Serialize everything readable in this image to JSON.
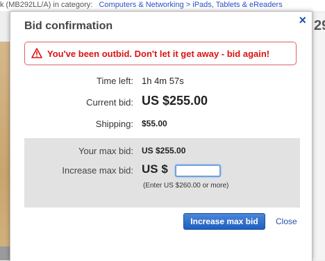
{
  "background": {
    "breadcrumb_prefix": "k (MB292LL/A) in category:",
    "breadcrumb_link": "Computers & Networking > iPads, Tablets & eReaders",
    "price_fragment": "29"
  },
  "dialog": {
    "title": "Bid confirmation",
    "close_symbol": "×",
    "alert": {
      "icon": "warning-icon",
      "text": "You've been outbid. Don't let it get away - bid again!",
      "color": "#dd1111"
    },
    "time_left": {
      "label": "Time left:",
      "value": "1h  4m  57s"
    },
    "current_bid": {
      "label": "Current bid:",
      "value": "US $255.00"
    },
    "shipping": {
      "label": "Shipping:",
      "value": "$55.00"
    },
    "max_bid": {
      "label": "Your max bid:",
      "value": "US $255.00"
    },
    "increase": {
      "label": "Increase max bid:",
      "currency": "US $",
      "input_value": "",
      "hint": "(Enter US $260.00 or more)"
    },
    "primary_button": "Increase max bid",
    "close_link": "Close"
  },
  "colors": {
    "accent": "#2450a8",
    "button": "#2a68c8",
    "alert_border": "#e06060"
  }
}
